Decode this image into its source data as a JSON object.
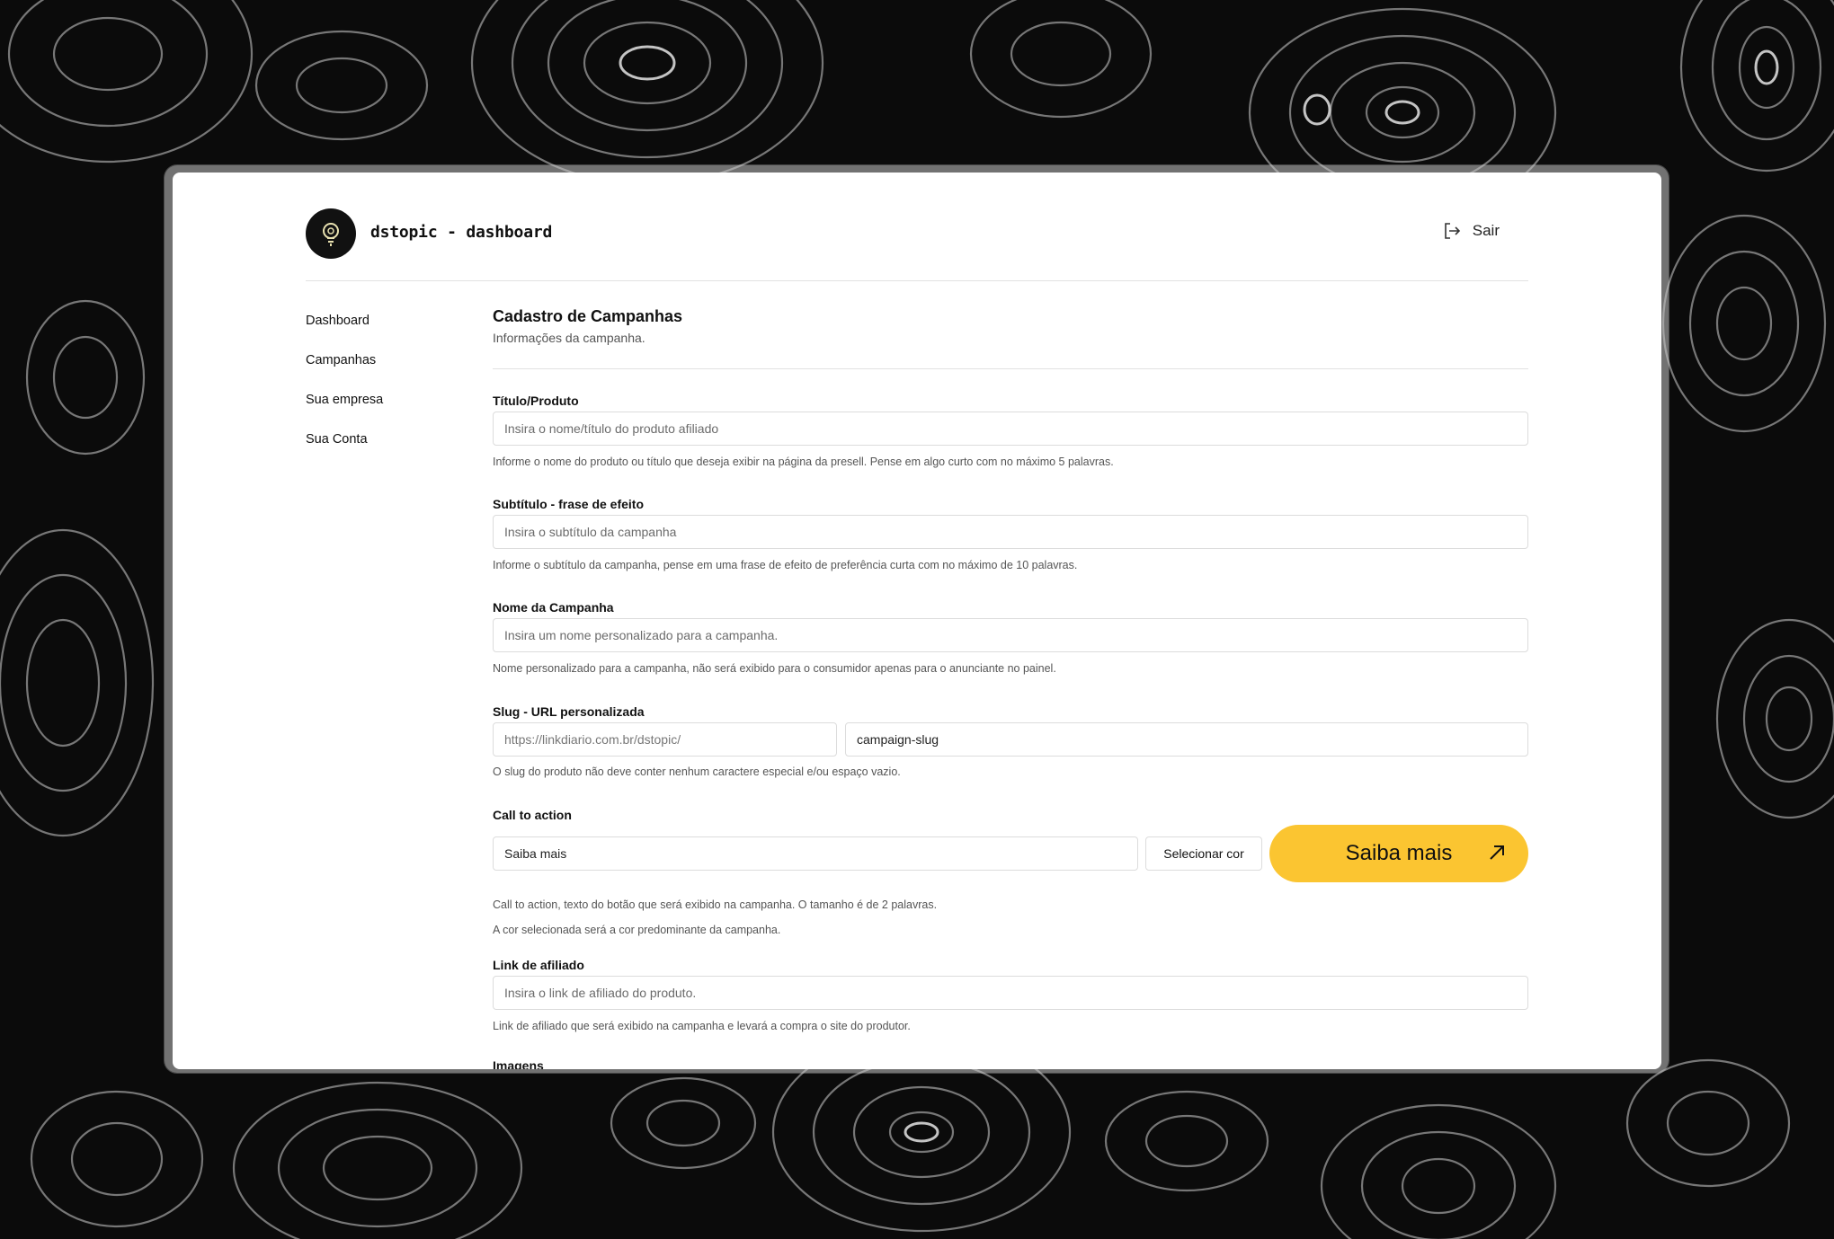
{
  "app": {
    "brand": "dstopic - dashboard",
    "signout_label": "Sair"
  },
  "sidebar": {
    "items": [
      {
        "label": "Dashboard"
      },
      {
        "label": "Campanhas"
      },
      {
        "label": "Sua empresa"
      },
      {
        "label": "Sua Conta"
      }
    ]
  },
  "page": {
    "title": "Cadastro de Campanhas",
    "subtitle": "Informações da campanha."
  },
  "form": {
    "titulo": {
      "label": "Título/Produto",
      "placeholder": "Insira o nome/título do produto afiliado",
      "help": "Informe o nome do produto ou título que deseja exibir na página da presell. Pense em algo curto com no máximo 5 palavras."
    },
    "subtitulo": {
      "label": "Subtítulo - frase de efeito",
      "placeholder": "Insira o subtítulo da campanha",
      "help": "Informe o subtítulo da campanha, pense em uma frase de efeito de preferência curta com no máximo de 10 palavras."
    },
    "nome": {
      "label": "Nome da Campanha",
      "placeholder": "Insira um nome personalizado para a campanha.",
      "help": "Nome personalizado para a campanha, não será exibido para o consumidor apenas para o anunciante no painel."
    },
    "slug": {
      "label": "Slug - URL personalizada",
      "prefix": "https://linkdiario.com.br/dstopic/",
      "value": "campaign-slug",
      "help": "O slug do produto não deve conter nenhum caractere especial e/ou espaço vazio."
    },
    "cta": {
      "label": "Call to action",
      "value": "Saiba mais",
      "color_button": "Selecionar cor",
      "preview_label": "Saiba mais",
      "preview_color": "#FBC531",
      "help1": "Call to action, texto do botão que será exibido na campanha. O tamanho é de 2 palavras.",
      "help2": "A cor selecionada será a cor predominante da campanha."
    },
    "link": {
      "label": "Link de afiliado",
      "placeholder": "Insira o link de afiliado do produto.",
      "help": "Link de afiliado que será exibido na campanha e levará a compra o site do produtor."
    },
    "imagens": {
      "label": "Imagens"
    }
  },
  "colors": {
    "background": "#0b0b0b",
    "panel": "#ffffff",
    "accent": "#FBC531"
  }
}
